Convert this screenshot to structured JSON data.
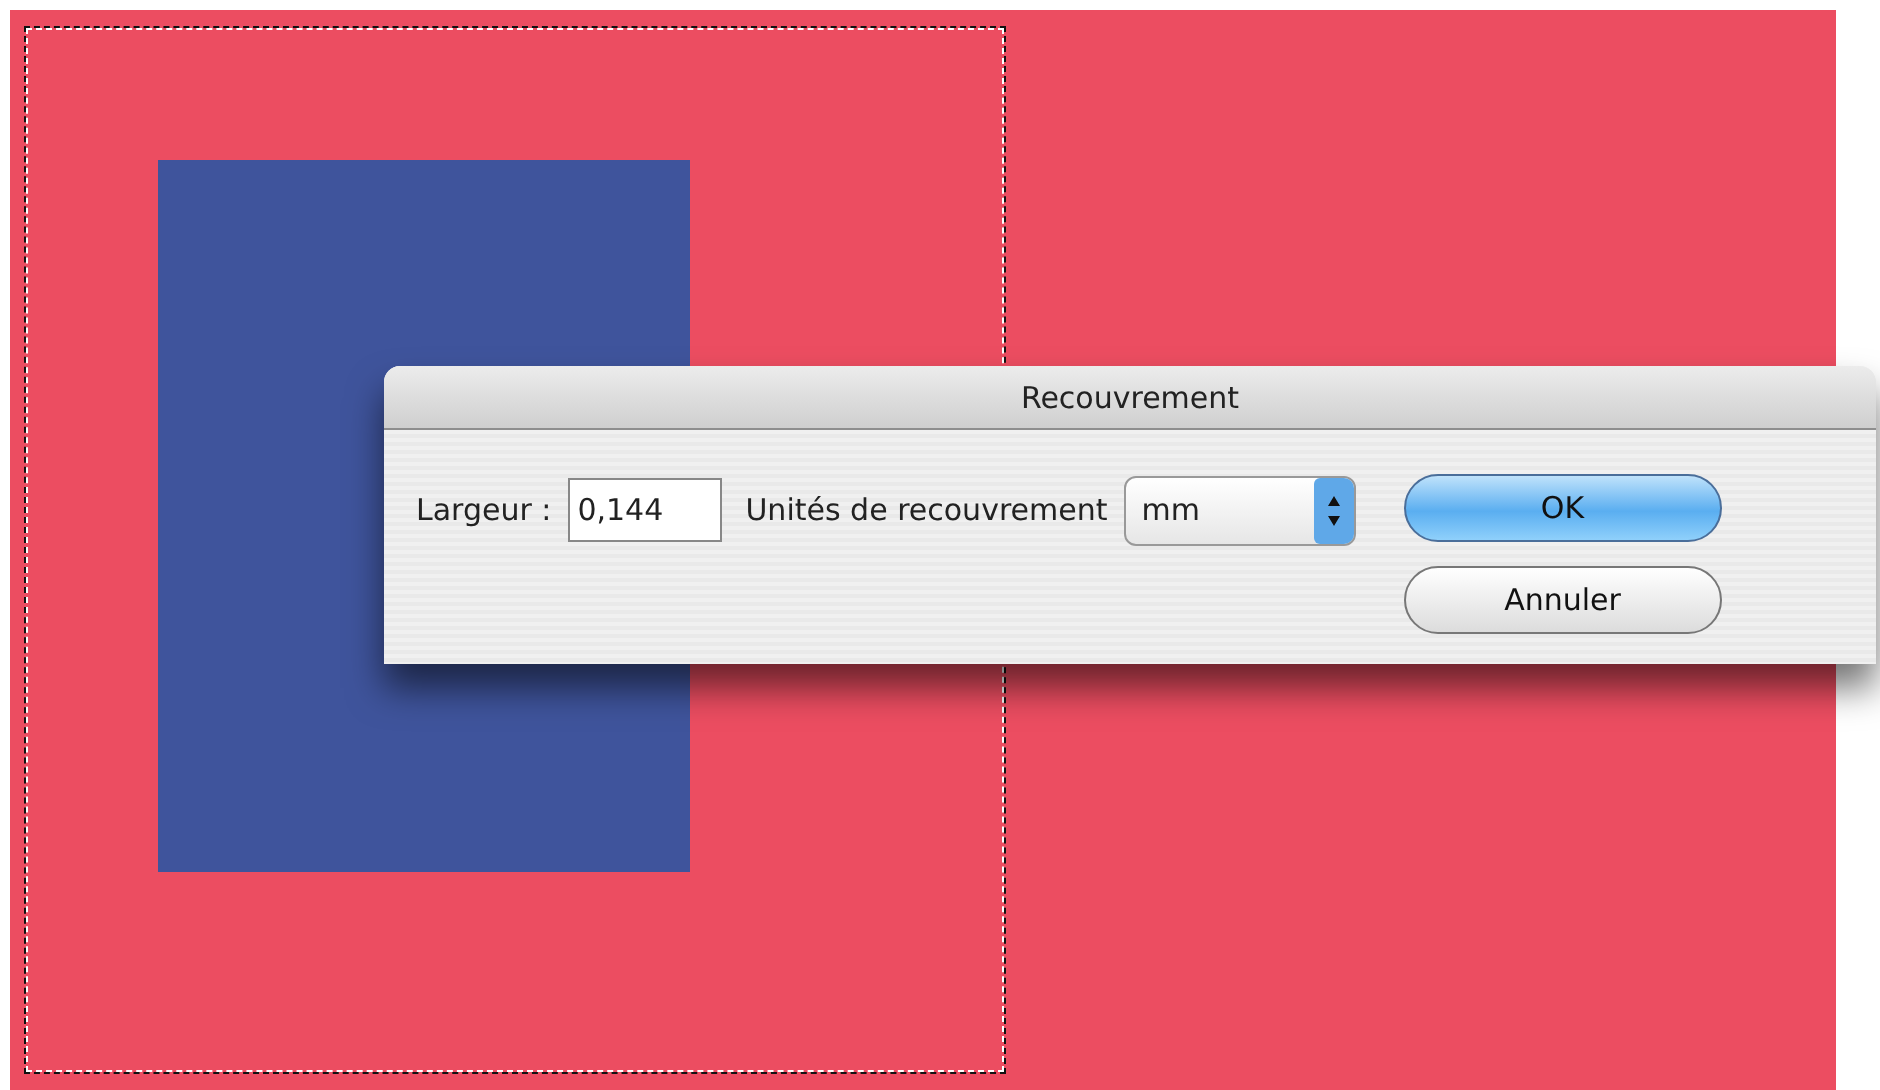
{
  "dialog": {
    "title": "Recouvrement",
    "width_label": "Largeur :",
    "width_value": "0,144",
    "units_label": "Unités de recouvrement",
    "units_value": "mm",
    "buttons": [
      {
        "label": "OK",
        "default": true
      },
      {
        "label": "Annuler",
        "default": false
      }
    ]
  }
}
